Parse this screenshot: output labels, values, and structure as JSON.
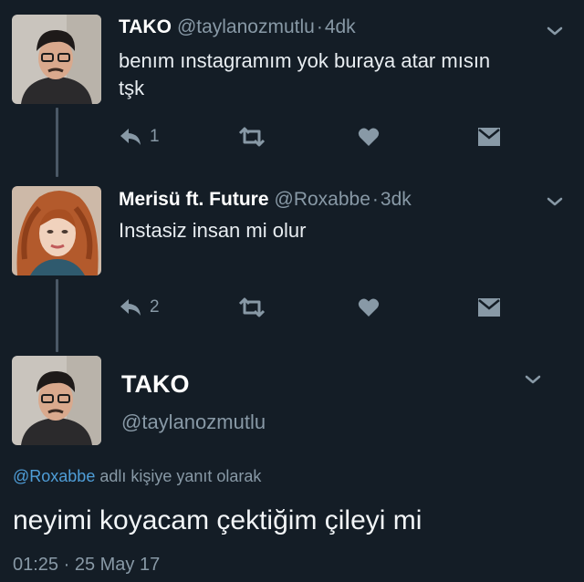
{
  "tweets": [
    {
      "name": "TAKO",
      "handle": "@taylanozmutlu",
      "sep": "·",
      "time": "4dk",
      "text_lines": [
        "benım ınstagramım yok buraya atar mısın",
        "tşk"
      ],
      "reply_count": "1"
    },
    {
      "name": "Merisü ft. Future",
      "handle": "@Roxabbe",
      "sep": "·",
      "time": "3dk",
      "text_lines": [
        "Instasiz insan mi olur"
      ],
      "reply_count": "2"
    }
  ],
  "detail": {
    "name": "TAKO",
    "handle": "@taylanozmutlu",
    "reply_to_handle": "@Roxabbe",
    "reply_context": " adlı kişiye yanıt olarak",
    "text": "neyimi koyacam çektiğim çileyi mi",
    "timestamp": "01:25 · 25 May 17"
  },
  "colors": {
    "background": "#141d26",
    "secondary_text": "#8899a6",
    "link": "#4f9ed8",
    "icon": "#8899a6"
  },
  "icons": [
    "chevron-down-icon",
    "reply-icon",
    "retweet-icon",
    "like-heart-icon",
    "direct-message-icon"
  ]
}
